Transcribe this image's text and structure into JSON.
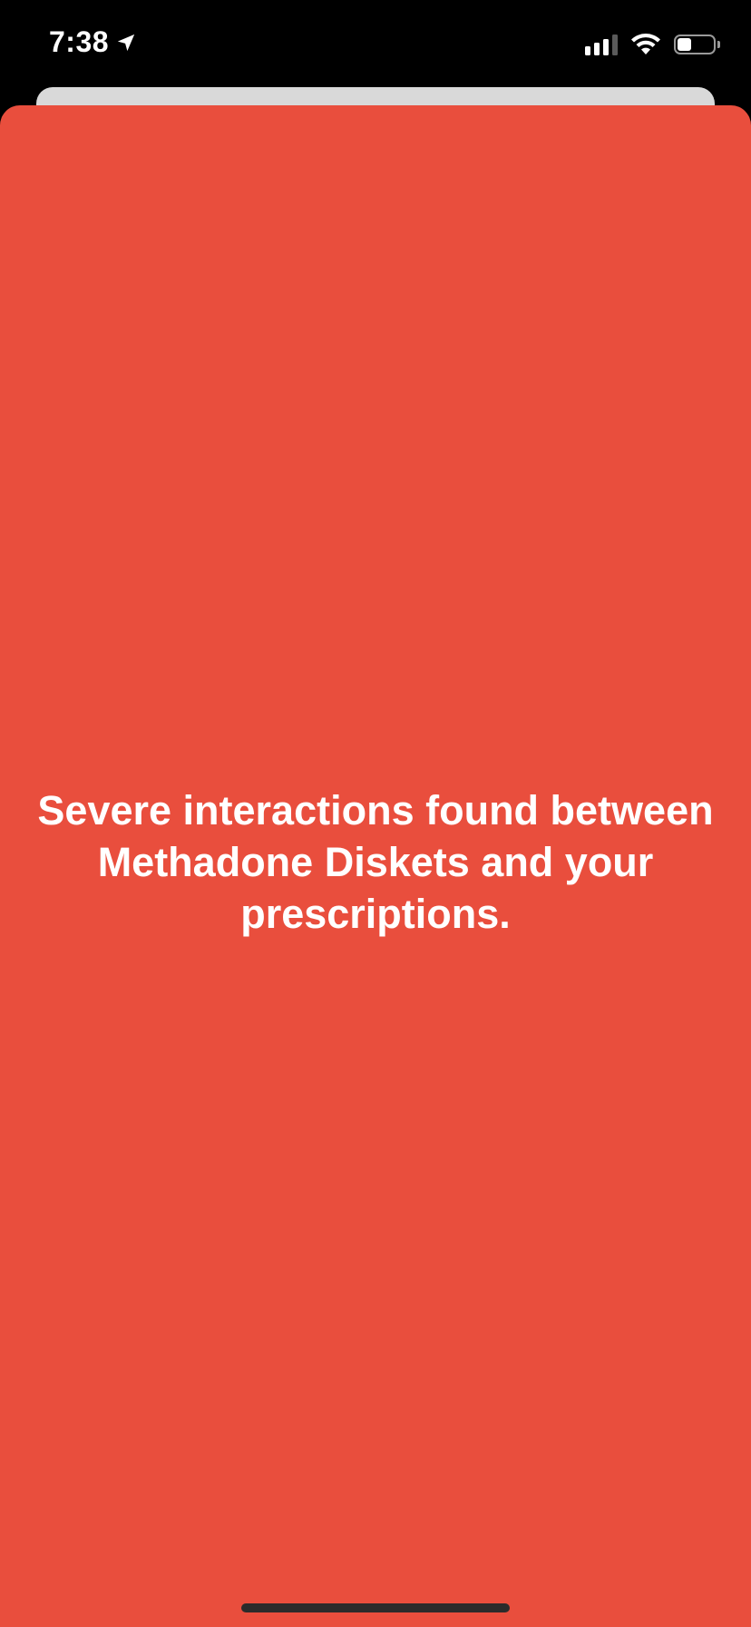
{
  "status_bar": {
    "time": "7:38",
    "location_icon": "location-arrow-icon",
    "signal_icon": "cellular-signal-icon",
    "signal_bars_active": 3,
    "signal_bars_total": 4,
    "wifi_icon": "wifi-icon",
    "battery_icon": "battery-icon",
    "battery_level": 0.4
  },
  "alert": {
    "message": "Severe interactions found between Methadone Diskets and your prescriptions."
  },
  "colors": {
    "alert_background": "#E94E3D",
    "status_bar_background": "#000000",
    "text": "#FFFFFF",
    "back_card": "#D9D9D9",
    "home_indicator": "#2B2B2B"
  }
}
